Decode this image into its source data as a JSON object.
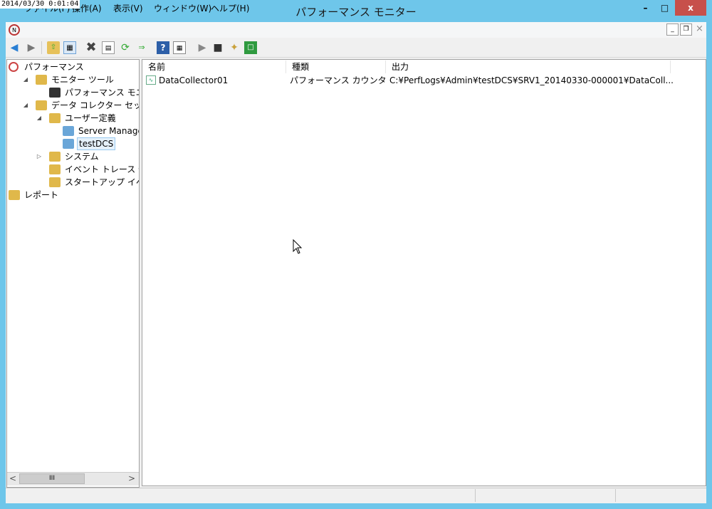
{
  "timestamp": "2014/03/30 0:01:04",
  "window": {
    "title": "パフォーマンス モニター",
    "min_label": "–",
    "max_label": "□",
    "close_label": "x"
  },
  "menu": {
    "items": [
      "ファイル(F)",
      "操作(A)",
      "表示(V)",
      "ウィンドウ(W)",
      "ヘルプ(H)"
    ],
    "mdi_min": "_",
    "mdi_restore": "❐",
    "mdi_close": "×"
  },
  "toolbar": {
    "icons": [
      "back-arrow-icon",
      "forward-arrow-icon",
      "up-folder-icon",
      "show-hide-tree-icon",
      "delete-icon",
      "properties-icon",
      "refresh-icon",
      "export-list-icon",
      "help-icon",
      "action-pane-icon",
      "start-icon",
      "stop-icon",
      "new-icon",
      "notebook-icon"
    ]
  },
  "tree": {
    "nodes": [
      {
        "label": "パフォーマンス",
        "level": 0,
        "expander": "",
        "icon": "perfmon-icon",
        "color": "#c44"
      },
      {
        "label": "モニター ツール",
        "level": 1,
        "expander": "◢",
        "icon": "folder-icon",
        "color": "#e0b84a"
      },
      {
        "label": "パフォーマンス モニター",
        "level": 2,
        "expander": "",
        "icon": "monitor-graph-icon",
        "color": "#333"
      },
      {
        "label": "データ コレクター セット",
        "level": 1,
        "expander": "◢",
        "icon": "folder-icon",
        "color": "#e0b84a"
      },
      {
        "label": "ユーザー定義",
        "level": 2,
        "expander": "◢",
        "icon": "user-folder-icon",
        "color": "#e0b84a"
      },
      {
        "label": "Server Manager P",
        "level": 3,
        "expander": "",
        "icon": "dcs-icon",
        "color": "#6aa6d8"
      },
      {
        "label": "testDCS",
        "level": 3,
        "expander": "",
        "icon": "dcs-running-icon",
        "color": "#6aa6d8",
        "selected": true
      },
      {
        "label": "システム",
        "level": 2,
        "expander": "▷",
        "icon": "system-folder-icon",
        "color": "#e0b84a"
      },
      {
        "label": "イベント トレース セッション",
        "level": 2,
        "expander": "",
        "icon": "trace-folder-icon",
        "color": "#e0b84a"
      },
      {
        "label": "スタートアップ イベント トレ",
        "level": 2,
        "expander": "",
        "icon": "trace-folder-icon",
        "color": "#e0b84a"
      },
      {
        "label": "レポート",
        "level": 0,
        "expander": "▷",
        "icon": "report-folder-icon",
        "color": "#e0b84a"
      }
    ]
  },
  "list": {
    "columns": [
      "名前",
      "種類",
      "出力"
    ],
    "rows": [
      {
        "name": "DataCollector01",
        "type": "パフォーマンス カウンター",
        "output": "C:¥PerfLogs¥Admin¥testDCS¥SRV1_20140330-000001¥DataColl..."
      }
    ]
  },
  "scroll": {
    "left": "<",
    "right": ">",
    "thumb": "III"
  }
}
